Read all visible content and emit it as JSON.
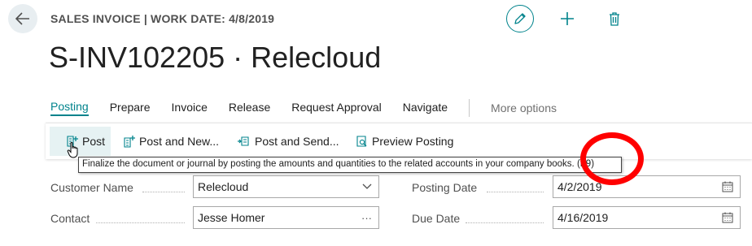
{
  "header": {
    "caption": "SALES INVOICE | WORK DATE: 4/8/2019",
    "title": "S-INV102205 · Relecloud"
  },
  "icons": {
    "back": "arrow-left-icon",
    "edit": "pencil-icon",
    "new": "plus-icon",
    "delete": "trash-icon"
  },
  "action_tabs": [
    {
      "label": "Posting",
      "active": true
    },
    {
      "label": "Prepare"
    },
    {
      "label": "Invoice"
    },
    {
      "label": "Release"
    },
    {
      "label": "Request Approval"
    },
    {
      "label": "Navigate"
    }
  ],
  "more_options": "More options",
  "posting_actions": [
    {
      "label": "Post"
    },
    {
      "label": "Post and New..."
    },
    {
      "label": "Post and Send..."
    },
    {
      "label": "Preview Posting"
    }
  ],
  "tooltip": "Finalize the document or journal by posting the amounts and quantities to the related accounts in your company books. (F9)",
  "fields": {
    "customer_name": {
      "label": "Customer Name",
      "value": "Relecloud"
    },
    "contact": {
      "label": "Contact",
      "value": "Jesse Homer",
      "button": "···"
    },
    "posting_date": {
      "label": "Posting Date",
      "value": "4/2/2019"
    },
    "due_date": {
      "label": "Due Date",
      "value": "4/16/2019"
    }
  },
  "colors": {
    "accent": "#00838c",
    "annotation": "#ff0000"
  }
}
